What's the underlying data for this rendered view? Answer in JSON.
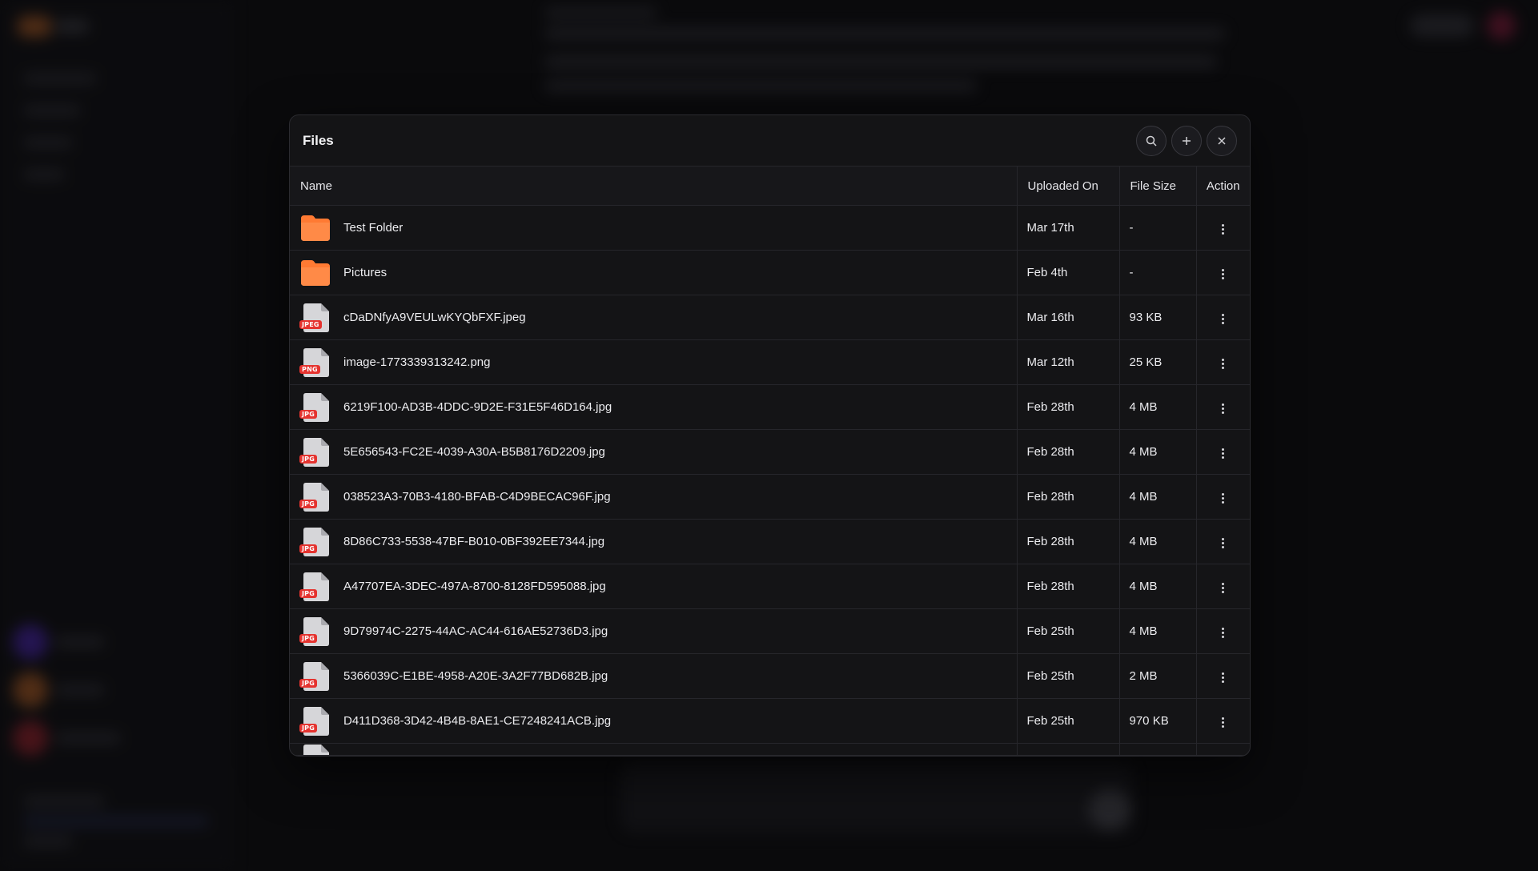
{
  "modal": {
    "title": "Files",
    "buttons": {
      "search": "search-icon",
      "add": "plus-icon",
      "close": "close-icon"
    }
  },
  "table": {
    "headers": {
      "name": "Name",
      "uploaded": "Uploaded On",
      "size": "File Size",
      "action": "Action"
    },
    "rows": [
      {
        "kind": "folder",
        "name": "Test Folder",
        "uploaded": "Mar 17th",
        "size": "-"
      },
      {
        "kind": "folder",
        "name": "Pictures",
        "uploaded": "Feb 4th",
        "size": "-"
      },
      {
        "kind": "file",
        "badge": "JPEG",
        "name": "cDaDNfyA9VEULwKYQbFXF.jpeg",
        "uploaded": "Mar 16th",
        "size": "93 KB"
      },
      {
        "kind": "file",
        "badge": "PNG",
        "name": "image-1773339313242.png",
        "uploaded": "Mar 12th",
        "size": "25 KB"
      },
      {
        "kind": "file",
        "badge": "JPG",
        "name": "6219F100-AD3B-4DDC-9D2E-F31E5F46D164.jpg",
        "uploaded": "Feb 28th",
        "size": "4 MB"
      },
      {
        "kind": "file",
        "badge": "JPG",
        "name": "5E656543-FC2E-4039-A30A-B5B8176D2209.jpg",
        "uploaded": "Feb 28th",
        "size": "4 MB"
      },
      {
        "kind": "file",
        "badge": "JPG",
        "name": "038523A3-70B3-4180-BFAB-C4D9BECAC96F.jpg",
        "uploaded": "Feb 28th",
        "size": "4 MB"
      },
      {
        "kind": "file",
        "badge": "JPG",
        "name": "8D86C733-5538-47BF-B010-0BF392EE7344.jpg",
        "uploaded": "Feb 28th",
        "size": "4 MB"
      },
      {
        "kind": "file",
        "badge": "JPG",
        "name": "A47707EA-3DEC-497A-8700-8128FD595088.jpg",
        "uploaded": "Feb 28th",
        "size": "4 MB"
      },
      {
        "kind": "file",
        "badge": "JPG",
        "name": "9D79974C-2275-44AC-AC44-616AE52736D3.jpg",
        "uploaded": "Feb 25th",
        "size": "4 MB"
      },
      {
        "kind": "file",
        "badge": "JPG",
        "name": "5366039C-E1BE-4958-A20E-3A2F77BD682B.jpg",
        "uploaded": "Feb 25th",
        "size": "2 MB"
      },
      {
        "kind": "file",
        "badge": "JPG",
        "name": "D411D368-3D42-4B4B-8AE1-CE7248241ACB.jpg",
        "uploaded": "Feb 25th",
        "size": "970 KB"
      }
    ]
  },
  "colors": {
    "folder": "#ff7a33",
    "badge": "#e5332f",
    "modal_bg": "#141416"
  }
}
